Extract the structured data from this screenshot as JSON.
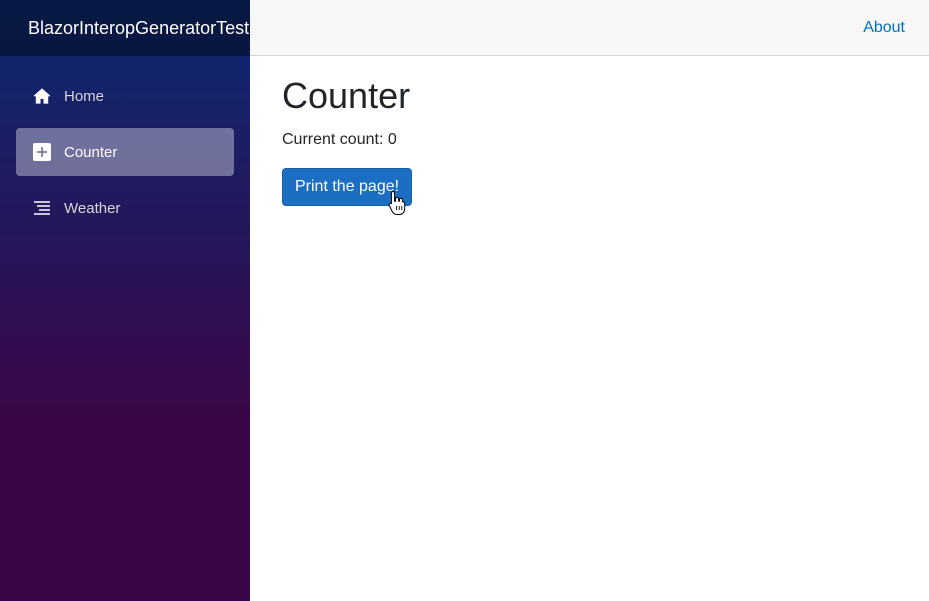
{
  "app": {
    "brand": "BlazorInteropGeneratorTest"
  },
  "sidebar": {
    "items": [
      {
        "label": "Home",
        "icon": "home-icon",
        "active": false
      },
      {
        "label": "Counter",
        "icon": "plus-square-icon",
        "active": true
      },
      {
        "label": "Weather",
        "icon": "list-icon",
        "active": false
      }
    ]
  },
  "topbar": {
    "about_label": "About"
  },
  "main": {
    "title": "Counter",
    "count_prefix": "Current count: ",
    "count_value": "0",
    "button_label": "Print the page!"
  },
  "colors": {
    "sidebar_top": "#0b2a73",
    "sidebar_bottom": "#3a0647",
    "button": "#1b6ec2",
    "link": "#0071c1"
  }
}
